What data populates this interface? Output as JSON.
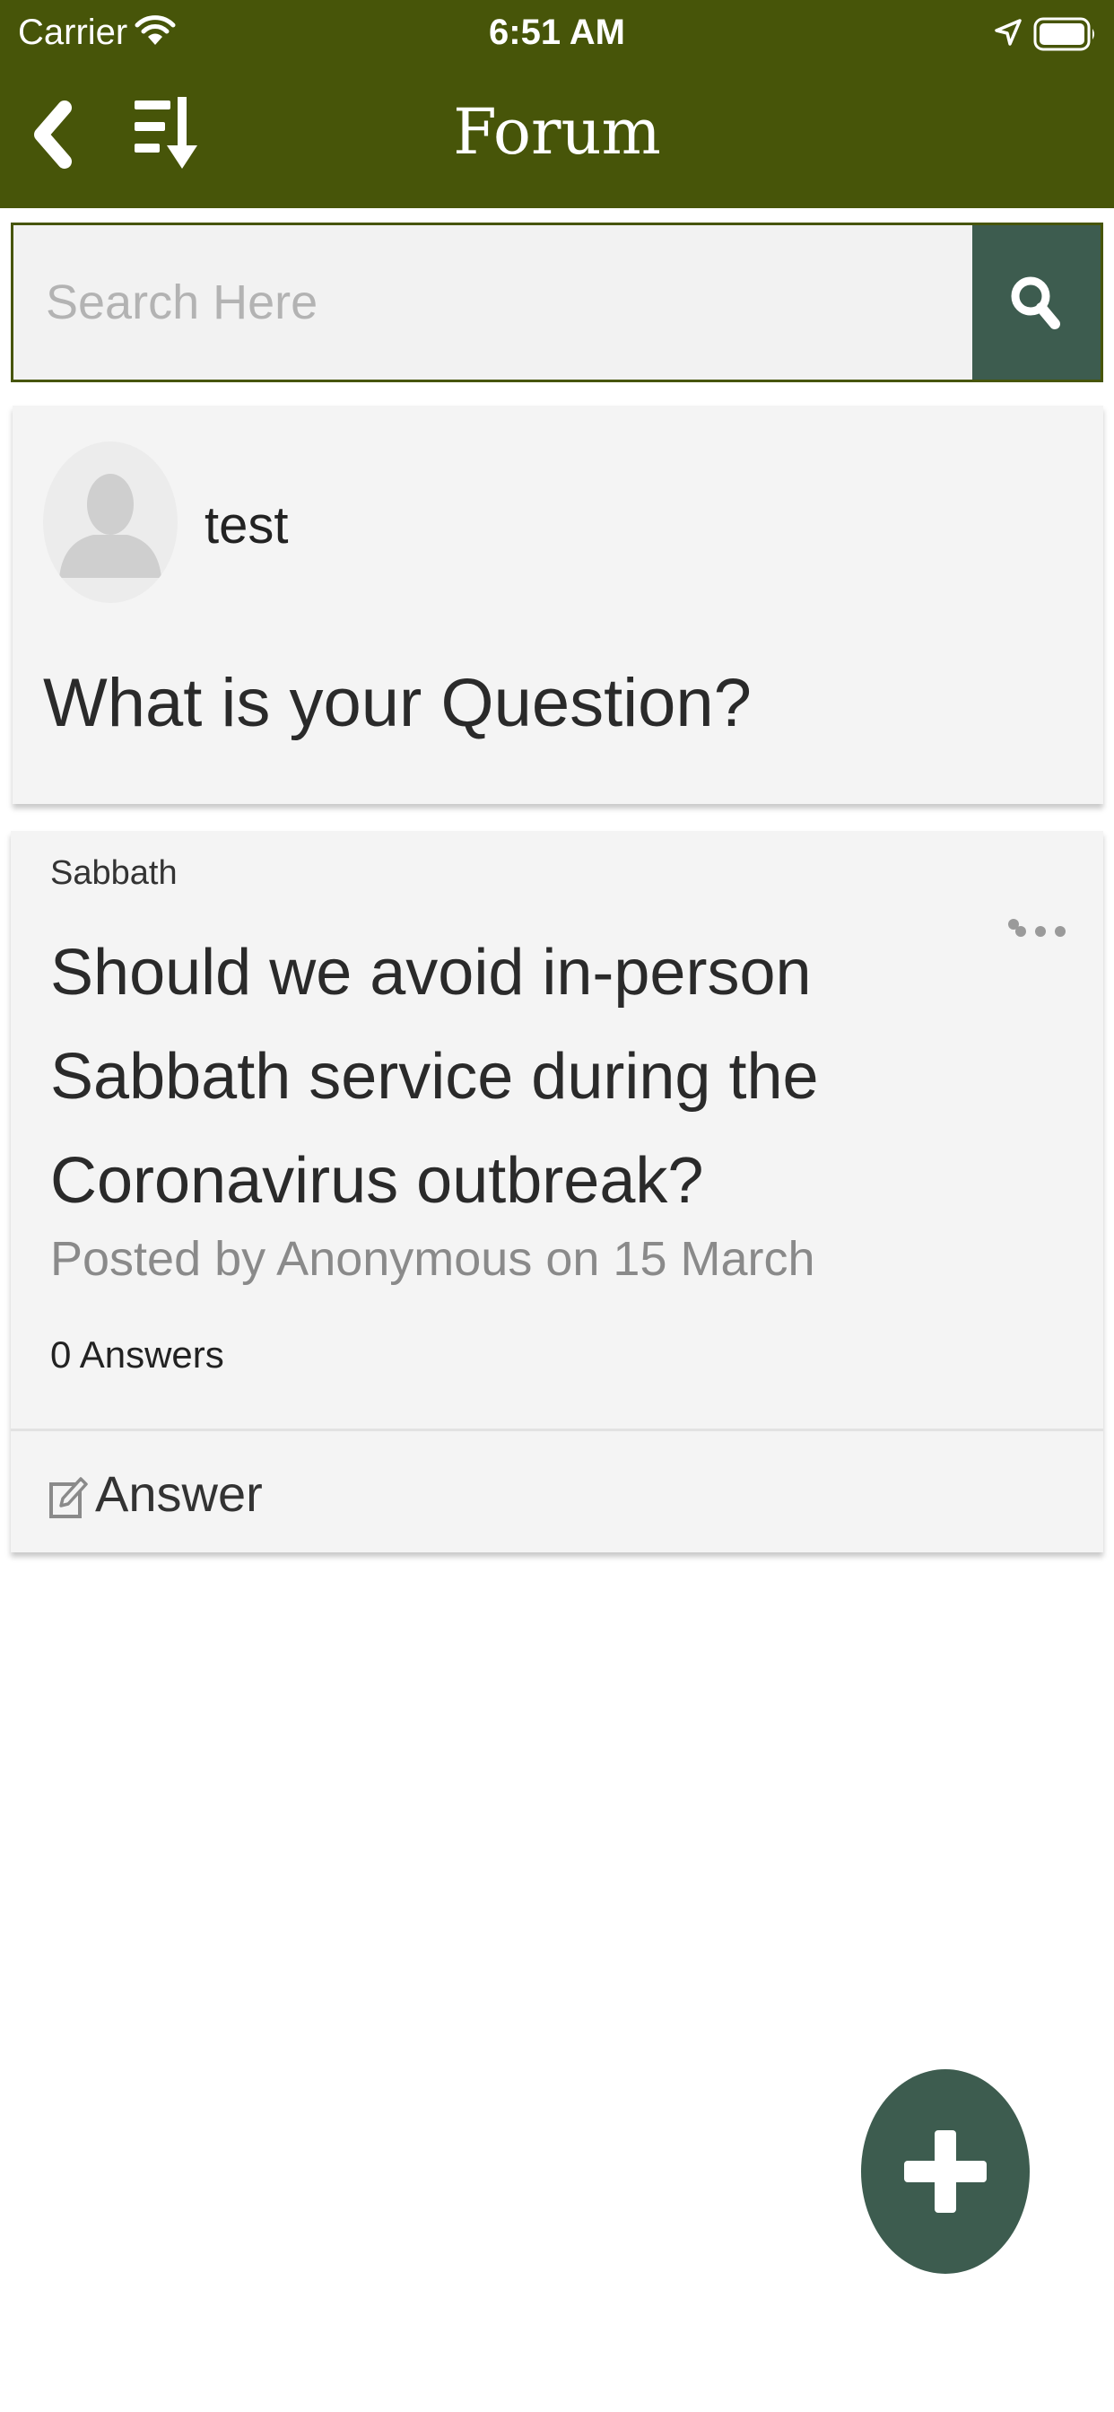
{
  "status_bar": {
    "carrier": "Carrier",
    "time": "6:51 AM",
    "icons": [
      "wifi-icon",
      "location-arrow-icon",
      "battery-icon"
    ]
  },
  "header": {
    "title": "Forum",
    "icons": [
      "chevron-left-icon",
      "sort-descending-icon"
    ]
  },
  "search": {
    "placeholder": "Search Here",
    "value": "",
    "icon": "search-icon"
  },
  "ask_card": {
    "username": "test",
    "prompt": "What is your Question?",
    "avatar_icon": "default-avatar-icon"
  },
  "posts": [
    {
      "category": "Sabbath",
      "title": "Should we avoid in-person Sabbath service during the Coronavirus outbreak?",
      "meta": "Posted by Anonymous on 15 March",
      "answers_count": "0 Answers",
      "answer_label": "Answer",
      "icons": [
        "more-horizontal-icon",
        "pencil-square-icon"
      ]
    }
  ],
  "fab": {
    "icon": "plus-icon"
  },
  "colors": {
    "header_bg": "#475509",
    "accent": "#3d5c4f",
    "card_bg": "#f4f4f4",
    "search_bg": "#f2f2f2"
  }
}
